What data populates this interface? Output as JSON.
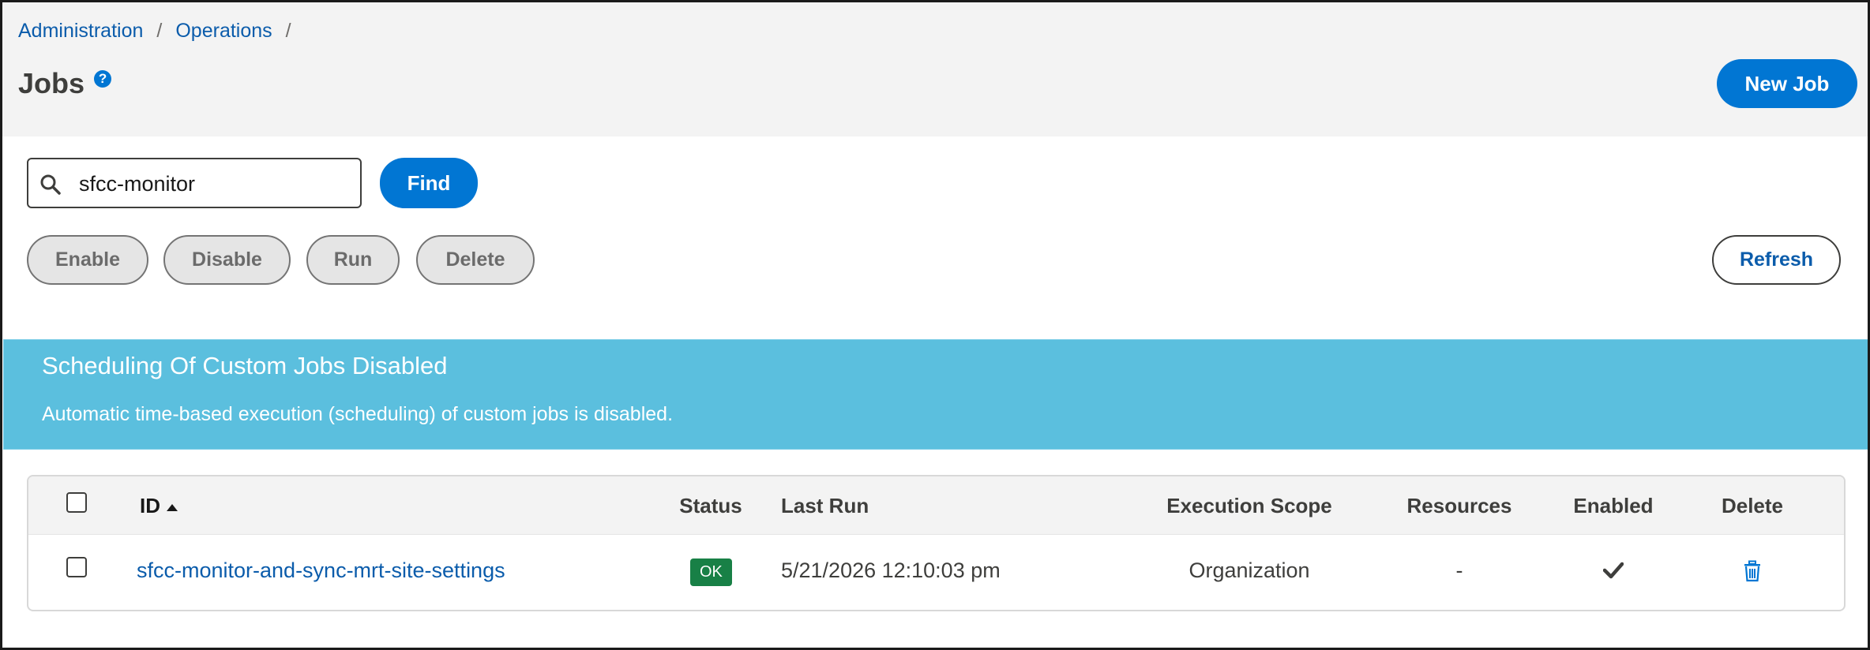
{
  "breadcrumb": {
    "items": [
      "Administration",
      "Operations"
    ],
    "separator": "/"
  },
  "page": {
    "title": "Jobs",
    "help_icon": "question-circle-icon",
    "new_job_label": "New Job"
  },
  "search": {
    "value": "sfcc-monitor",
    "find_label": "Find",
    "icon": "search-icon"
  },
  "actions": {
    "enable": "Enable",
    "disable": "Disable",
    "run": "Run",
    "delete": "Delete",
    "refresh": "Refresh"
  },
  "banner": {
    "title": "Scheduling Of Custom Jobs Disabled",
    "text": "Automatic time-based execution (scheduling) of custom jobs is disabled.",
    "color": "#5bbfde"
  },
  "table": {
    "columns": {
      "id": "ID",
      "status": "Status",
      "last_run": "Last Run",
      "execution_scope": "Execution Scope",
      "resources": "Resources",
      "enabled": "Enabled",
      "delete": "Delete"
    },
    "sort": {
      "column": "id",
      "direction": "ascending"
    },
    "rows": [
      {
        "id": "sfcc-monitor-and-sync-mrt-site-settings",
        "status": "OK",
        "last_run": "5/21/2026 12:10:03 pm",
        "execution_scope": "Organization",
        "resources": "-",
        "enabled_icon": "checkmark-icon",
        "delete_icon": "trash-icon"
      }
    ]
  },
  "colors": {
    "primary": "#0176d3",
    "link": "#0b5cab",
    "ok_badge": "#188046",
    "header_bg": "#f3f3f3"
  }
}
